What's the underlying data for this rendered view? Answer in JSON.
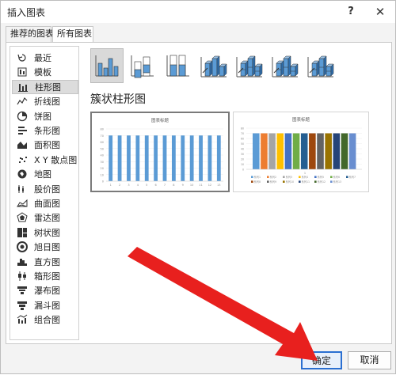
{
  "window": {
    "title": "插入图表",
    "help_label": "?",
    "close_label": "✕"
  },
  "tabs": [
    {
      "label": "推荐的图表",
      "active": false
    },
    {
      "label": "所有图表",
      "active": true
    }
  ],
  "sidebar": {
    "items": [
      {
        "label": "最近",
        "icon": "recent-icon"
      },
      {
        "label": "模板",
        "icon": "template-icon"
      },
      {
        "label": "柱形图",
        "icon": "column-chart-icon",
        "selected": true
      },
      {
        "label": "折线图",
        "icon": "line-chart-icon"
      },
      {
        "label": "饼图",
        "icon": "pie-chart-icon"
      },
      {
        "label": "条形图",
        "icon": "bar-chart-icon"
      },
      {
        "label": "面积图",
        "icon": "area-chart-icon"
      },
      {
        "label": "X Y 散点图",
        "icon": "scatter-chart-icon"
      },
      {
        "label": "地图",
        "icon": "map-chart-icon"
      },
      {
        "label": "股价图",
        "icon": "stock-chart-icon"
      },
      {
        "label": "曲面图",
        "icon": "surface-chart-icon"
      },
      {
        "label": "雷达图",
        "icon": "radar-chart-icon"
      },
      {
        "label": "树状图",
        "icon": "treemap-chart-icon"
      },
      {
        "label": "旭日图",
        "icon": "sunburst-chart-icon"
      },
      {
        "label": "直方图",
        "icon": "histogram-chart-icon"
      },
      {
        "label": "箱形图",
        "icon": "box-whisker-chart-icon"
      },
      {
        "label": "瀑布图",
        "icon": "waterfall-chart-icon"
      },
      {
        "label": "漏斗图",
        "icon": "funnel-chart-icon"
      },
      {
        "label": "组合图",
        "icon": "combo-chart-icon"
      }
    ]
  },
  "main": {
    "section_title": "簇状柱形图",
    "subtypes": [
      "clustered-column-icon",
      "stacked-column-icon",
      "100-stacked-column-icon",
      "3d-clustered-column-icon",
      "3d-stacked-column-icon",
      "3d-100-stacked-column-icon",
      "3d-column-icon"
    ],
    "previews": [
      {
        "title": "图表标题",
        "bar_color": "#5b9bd5",
        "categories": [
          "1",
          "2",
          "3",
          "4",
          "5",
          "6",
          "7",
          "8",
          "9",
          "10",
          "11",
          "12",
          "13"
        ],
        "values": [
          70,
          70,
          70,
          70,
          70,
          70,
          70,
          70,
          70,
          70,
          70,
          70,
          70
        ],
        "ylim": [
          0,
          80
        ],
        "yticks": [
          "80",
          "70",
          "60",
          "50",
          "40",
          "30",
          "20",
          "10",
          "0"
        ]
      },
      {
        "title": "图表标题",
        "series_colors": [
          "#5b9bd5",
          "#ed7d31",
          "#a5a5a5",
          "#ffc000",
          "#4472c4",
          "#70ad47",
          "#255e91",
          "#9e480e",
          "#636363",
          "#997300",
          "#264478",
          "#43682b",
          "#698ed0"
        ],
        "values": [
          70,
          70,
          70,
          70,
          70,
          70,
          70,
          70,
          70,
          70,
          70,
          70,
          70
        ],
        "ylim": [
          0,
          80
        ],
        "yticks": [
          "80",
          "70",
          "60",
          "50",
          "40",
          "30",
          "20",
          "10",
          "0"
        ],
        "xlabel": "1",
        "legend": [
          "系列1",
          "系列2",
          "系列3",
          "系列4",
          "系列5",
          "系列6",
          "系列7",
          "系列8",
          "系列9",
          "系列10",
          "系列11",
          "系列12",
          "系列13"
        ]
      }
    ]
  },
  "footer": {
    "ok_label": "确定",
    "cancel_label": "取消"
  },
  "annotation": {
    "arrow_color": "#e8201e"
  }
}
